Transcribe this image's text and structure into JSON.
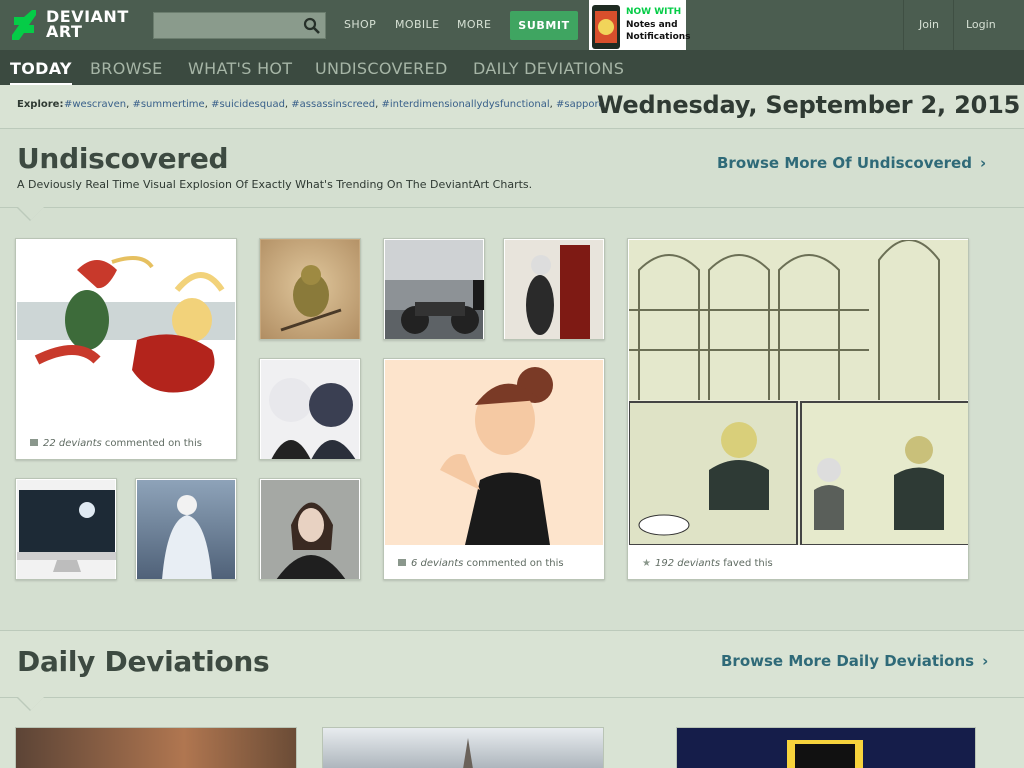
{
  "header": {
    "logo_line1": "DEVIANT",
    "logo_line2": "ART",
    "search_placeholder": "",
    "nav": [
      "SHOP",
      "MOBILE",
      "MORE"
    ],
    "submit_label": "SUBMIT",
    "promo_line1": "NOW WITH",
    "promo_line2": "Notes and",
    "promo_line3": "Notifications",
    "join_label": "Join",
    "login_label": "Login"
  },
  "tabs": [
    {
      "label": "TODAY",
      "active": true
    },
    {
      "label": "BROWSE",
      "active": false
    },
    {
      "label": "WHAT'S HOT",
      "active": false
    },
    {
      "label": "UNDISCOVERED",
      "active": false
    },
    {
      "label": "DAILY DEVIATIONS",
      "active": false
    }
  ],
  "explore": {
    "label": "Explore:",
    "tags": [
      "#wescraven",
      "#summertime",
      "#suicidesquad",
      "#assassinscreed",
      "#interdimensionallydysfunctional",
      "#sapporo"
    ]
  },
  "date": "Wednesday, September 2, 2015",
  "undiscovered": {
    "title": "Undiscovered",
    "subtitle": "A Deviously Real Time Visual Explosion Of Exactly What's Trending On The DeviantArt Charts.",
    "browse_label": "Browse More Of Undiscovered",
    "captions": {
      "fighters": {
        "count": "22 deviants",
        "rest": "commented on this"
      },
      "girl": {
        "count": "6 deviants",
        "rest": "commented on this"
      },
      "library": {
        "count": "192 deviants",
        "rest": "faved this"
      }
    }
  },
  "daily": {
    "title": "Daily Deviations",
    "browse_label": "Browse More Daily Deviations"
  },
  "colors": {
    "accent_green": "#05cc47",
    "header_bg": "#4b5d50",
    "tabbar_bg": "#3b4a40",
    "page_bg": "#d4dfd0",
    "link_teal": "#2f6a78"
  }
}
